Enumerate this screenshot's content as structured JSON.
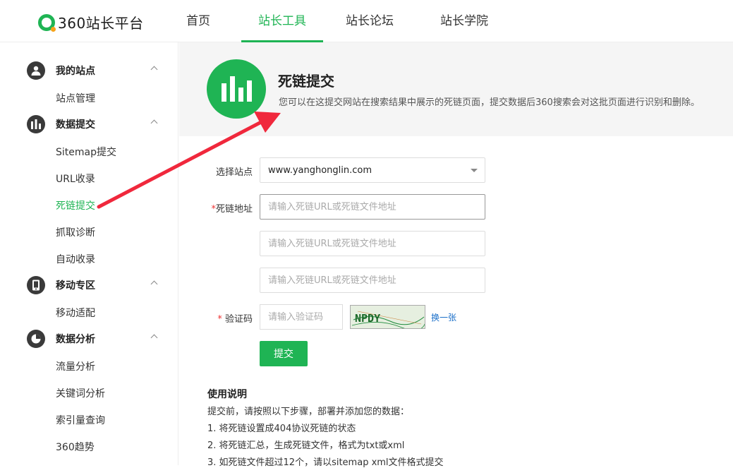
{
  "brand": {
    "logo_text": "360站长平台"
  },
  "nav": [
    {
      "label": "首页"
    },
    {
      "label": "站长工具"
    },
    {
      "label": "站长论坛"
    },
    {
      "label": "站长学院"
    }
  ],
  "sidebar": {
    "groups": [
      {
        "label": "我的站点",
        "icon": "user-icon",
        "items": [
          {
            "label": "站点管理"
          }
        ]
      },
      {
        "label": "数据提交",
        "icon": "bar-chart-icon",
        "items": [
          {
            "label": "Sitemap提交"
          },
          {
            "label": "URL收录"
          },
          {
            "label": "死链提交"
          },
          {
            "label": "抓取诊断"
          },
          {
            "label": "自动收录"
          }
        ]
      },
      {
        "label": "移动专区",
        "icon": "mobile-icon",
        "items": [
          {
            "label": "移动适配"
          }
        ]
      },
      {
        "label": "数据分析",
        "icon": "pie-chart-icon",
        "items": [
          {
            "label": "流量分析"
          },
          {
            "label": "关键词分析"
          },
          {
            "label": "索引量查询"
          },
          {
            "label": "360趋势"
          }
        ]
      }
    ],
    "active_item": "死链提交"
  },
  "panel": {
    "title": "死链提交",
    "description": "您可以在这提交网站在搜索结果中展示的死链页面，提交数据后360搜索会对这批页面进行识别和删除。"
  },
  "form": {
    "site_label": "选择站点",
    "site_value": "www.yanghonglin.com",
    "deadlink_label": "死链地址",
    "required_mark": "*",
    "url_placeholder": "请输入死链URL或死链文件地址",
    "captcha_label": "验证码",
    "captcha_placeholder": "请输入验证码",
    "captcha_text": "NPDY",
    "refresh_label": "换一张",
    "submit_label": "提交"
  },
  "usage": {
    "title": "使用说明",
    "lines": [
      "提交前，请按照以下步骤，部署并添加您的数据：",
      "1. 将死链设置成404协议死链的状态",
      "2. 将死链汇总，生成死链文件，格式为txt或xml",
      "3. 如死链文件超过12个，请以sitemap xml文件格式提交"
    ]
  },
  "colors": {
    "accent": "#1fb454",
    "annotation_arrow": "#f0283c",
    "link": "#1a6fc9"
  }
}
